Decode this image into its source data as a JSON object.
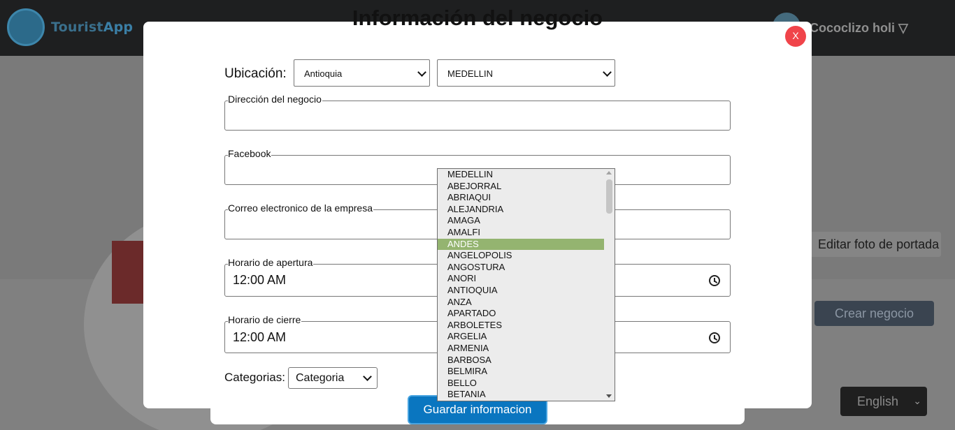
{
  "header": {
    "logo_text_main": "Tourist",
    "logo_text_accent": "App",
    "user_name": "Cococlizo holi ▽"
  },
  "background": {
    "edit_cover_label": "Editar foto de portada",
    "create_business_label": "Crear negocio",
    "language_selected": "English"
  },
  "modal": {
    "title": "Información del negocio",
    "close_label": "X",
    "location_label": "Ubicación:",
    "department_selected": "Antioquia",
    "city_selected": "MEDELLIN",
    "fields": {
      "address_label": "Dirección del negocio",
      "facebook_label": "Facebook",
      "email_label": "Correo electronico de la empresa",
      "opening_label": "Horario de apertura",
      "opening_value": "12:00  AM",
      "closing_label": "Horario de cierre",
      "closing_value": "12:00  AM"
    },
    "categories_label": "Categorias:",
    "category_selected": "Categoria",
    "save_label": "Guardar informacion"
  },
  "city_dropdown": {
    "highlighted": "ANDES",
    "options": [
      "MEDELLIN",
      "ABEJORRAL",
      "ABRIAQUI",
      "ALEJANDRIA",
      "AMAGA",
      "AMALFI",
      "ANDES",
      "ANGELOPOLIS",
      "ANGOSTURA",
      "ANORI",
      "ANTIOQUIA",
      "ANZA",
      "APARTADO",
      "ARBOLETES",
      "ARGELIA",
      "ARMENIA",
      "BARBOSA",
      "BELMIRA",
      "BELLO",
      "BETANIA"
    ]
  },
  "colors": {
    "primary_button": "#0a76c0",
    "close_button": "#f0444a",
    "highlight_option": "#94b470"
  }
}
